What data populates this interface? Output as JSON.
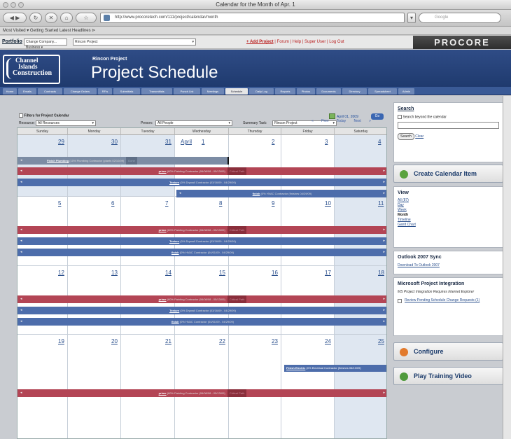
{
  "window": {
    "title": "Calendar for the Month of Apr. 1"
  },
  "browser": {
    "url": "http://www.procoretech.com/111/project/calendar/month",
    "search_placeholder": "Google",
    "bookmarks": "Most Visited ▾   Getting Started   Latest Headlines ⊳"
  },
  "app": {
    "portfolio_label": "Portfolio",
    "company_select": "Change Company... Business ▾",
    "project_select": "Rincon Project",
    "links": {
      "add_project": "+ Add Project",
      "rest": "| Forum | Help | Super User | Log Out"
    },
    "brand": "PROCORE",
    "logo": {
      "line1": "Channel",
      "line2": "Islands",
      "line3": "Construction"
    },
    "project_name": "Rincon Project",
    "page_title": "Project Schedule"
  },
  "tabs": [
    "Home",
    "Emails",
    "Contracts",
    "Change Orders",
    "RFIs",
    "Submittals",
    "Transmittals",
    "Punch List",
    "Meetings",
    "Schedule",
    "Daily Log",
    "Reports",
    "Photos",
    "Documents",
    "Directory",
    "Spreadsheet",
    "Admin"
  ],
  "filters": {
    "title": "Filters for Project Calendar",
    "resource_label": "Resource:",
    "resource_value": "All Resources",
    "person_label": "Person:",
    "person_value": "All People",
    "summary_label": "Summary Task:",
    "summary_value": "Rincon Project",
    "date_value": "April 01, 2009",
    "go_label": "Go"
  },
  "pager": {
    "prev": "« Prev",
    "today": "Today",
    "next": "Next »"
  },
  "calendar": {
    "days": [
      "Sunday",
      "Monday",
      "Tuesday",
      "Wednesday",
      "Thursday",
      "Friday",
      "Saturday"
    ],
    "weeks": [
      [
        "29",
        "30",
        "31",
        "1",
        "2",
        "3",
        "4"
      ],
      [
        "5",
        "6",
        "7",
        "8",
        "9",
        "10",
        "11"
      ],
      [
        "12",
        "13",
        "14",
        "15",
        "16",
        "17",
        "18"
      ],
      [
        "19",
        "20",
        "21",
        "22",
        "23",
        "24",
        "25"
      ]
    ],
    "month_label": "April",
    "events": {
      "finish_plumbing": {
        "link": "Finish Plumbing",
        "desc": "(10% Plumbing Contractor (plants 02/10/09)",
        "tag": "Done"
      },
      "prime": {
        "link": "prime",
        "desc": "(60% Painting Contractor (06/08/08 - 05/13/09)",
        "tag": "Critical Path"
      },
      "texture": {
        "link": "Texture",
        "desc": "(0% Drywall Contractor (03/16/09 - 04/29/09)"
      },
      "finish_hvac": {
        "link": "finish",
        "desc": "(0% HVAC Contractor (finishes 04/29/09)"
      },
      "finish_hvac2": {
        "link": "finish",
        "desc": "(0% HVAC Contractor (04/01/09 - 04/29/09)"
      },
      "finish_electric": {
        "link": "Finish Electric",
        "desc": "(0% Electrical Contractor (finishes 06/13/09)"
      }
    }
  },
  "sidebar": {
    "search_title": "Search",
    "search_beyond": "Search beyond the calendar",
    "search_button": "Search",
    "clear_link": "Clear",
    "create_button": "Create Calendar Item",
    "view_title": "View",
    "view_items": [
      "All (87)",
      "Day",
      "Week",
      "Month",
      "Timeline",
      "Gantt Chart"
    ],
    "view_active": "Month",
    "outlook_title": "Outlook 2007 Sync",
    "outlook_link": "Download To Outlook 2007",
    "msproject_title": "Microsoft Project Integration",
    "msproject_text": "MS Project Integration Requires Internet Explorer",
    "review_link": "Review Pending Schedule Change Requests (1)",
    "configure_button": "Configure",
    "video_button": "Play Training Video"
  },
  "colors": {
    "header": "#2f4c86",
    "red_bar": "#b34555",
    "blue_bar": "#4d6dab",
    "weekend": "#dfe7f1"
  }
}
